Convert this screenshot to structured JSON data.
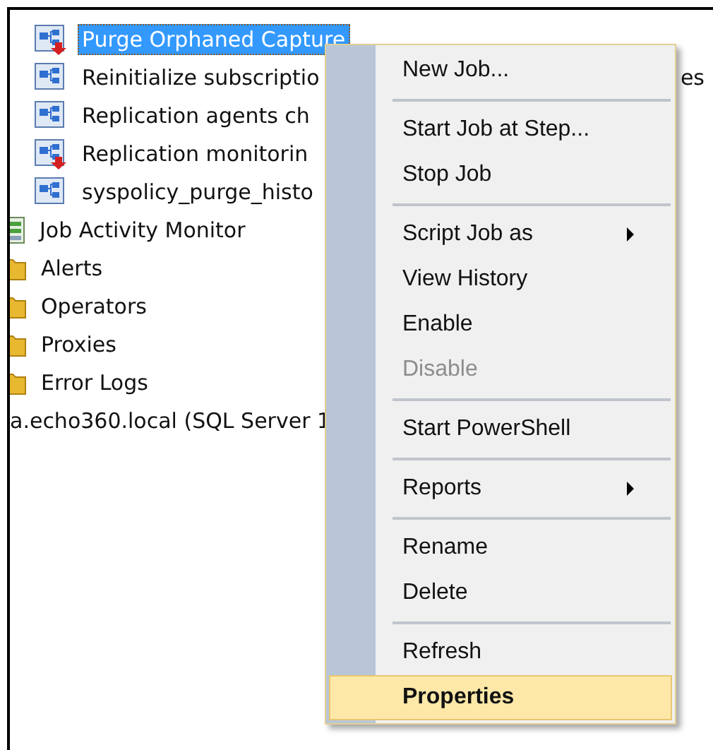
{
  "tree": {
    "jobs": [
      {
        "label": "Purge Orphaned Capture",
        "selected": true,
        "disabled": true
      },
      {
        "label": "Reinitialize subscriptio",
        "selected": false,
        "disabled": false,
        "hidden_tail": "es"
      },
      {
        "label": "Replication agents ch",
        "selected": false,
        "disabled": false
      },
      {
        "label": "Replication monitorin",
        "selected": false,
        "disabled": true
      },
      {
        "label": "syspolicy_purge_histo",
        "selected": false,
        "disabled": false
      }
    ],
    "nodes": [
      {
        "kind": "monitor",
        "label": "Job Activity Monitor"
      },
      {
        "kind": "folder",
        "label": "Alerts"
      },
      {
        "kind": "folder",
        "label": "Operators"
      },
      {
        "kind": "folder",
        "label": "Proxies"
      },
      {
        "kind": "folder",
        "label": "Error Logs"
      },
      {
        "kind": "server",
        "label": "a.echo360.local (SQL Server 1"
      }
    ]
  },
  "context_menu": {
    "items": [
      {
        "kind": "item",
        "label": "New Job...",
        "submenu": false,
        "disabled": false,
        "selected": false
      },
      {
        "kind": "separator"
      },
      {
        "kind": "item",
        "label": "Start Job at Step...",
        "submenu": false,
        "disabled": false,
        "selected": false
      },
      {
        "kind": "item",
        "label": "Stop Job",
        "submenu": false,
        "disabled": false,
        "selected": false
      },
      {
        "kind": "separator"
      },
      {
        "kind": "item",
        "label": "Script Job as",
        "submenu": true,
        "disabled": false,
        "selected": false
      },
      {
        "kind": "item",
        "label": "View History",
        "submenu": false,
        "disabled": false,
        "selected": false
      },
      {
        "kind": "item",
        "label": "Enable",
        "submenu": false,
        "disabled": false,
        "selected": false
      },
      {
        "kind": "item",
        "label": "Disable",
        "submenu": false,
        "disabled": true,
        "selected": false
      },
      {
        "kind": "separator"
      },
      {
        "kind": "item",
        "label": "Start PowerShell",
        "submenu": false,
        "disabled": false,
        "selected": false
      },
      {
        "kind": "separator"
      },
      {
        "kind": "item",
        "label": "Reports",
        "submenu": true,
        "disabled": false,
        "selected": false
      },
      {
        "kind": "separator"
      },
      {
        "kind": "item",
        "label": "Rename",
        "submenu": false,
        "disabled": false,
        "selected": false
      },
      {
        "kind": "item",
        "label": "Delete",
        "submenu": false,
        "disabled": false,
        "selected": false
      },
      {
        "kind": "separator"
      },
      {
        "kind": "item",
        "label": "Refresh",
        "submenu": false,
        "disabled": false,
        "selected": false
      },
      {
        "kind": "item",
        "label": "Properties",
        "submenu": false,
        "disabled": false,
        "selected": true
      }
    ]
  }
}
